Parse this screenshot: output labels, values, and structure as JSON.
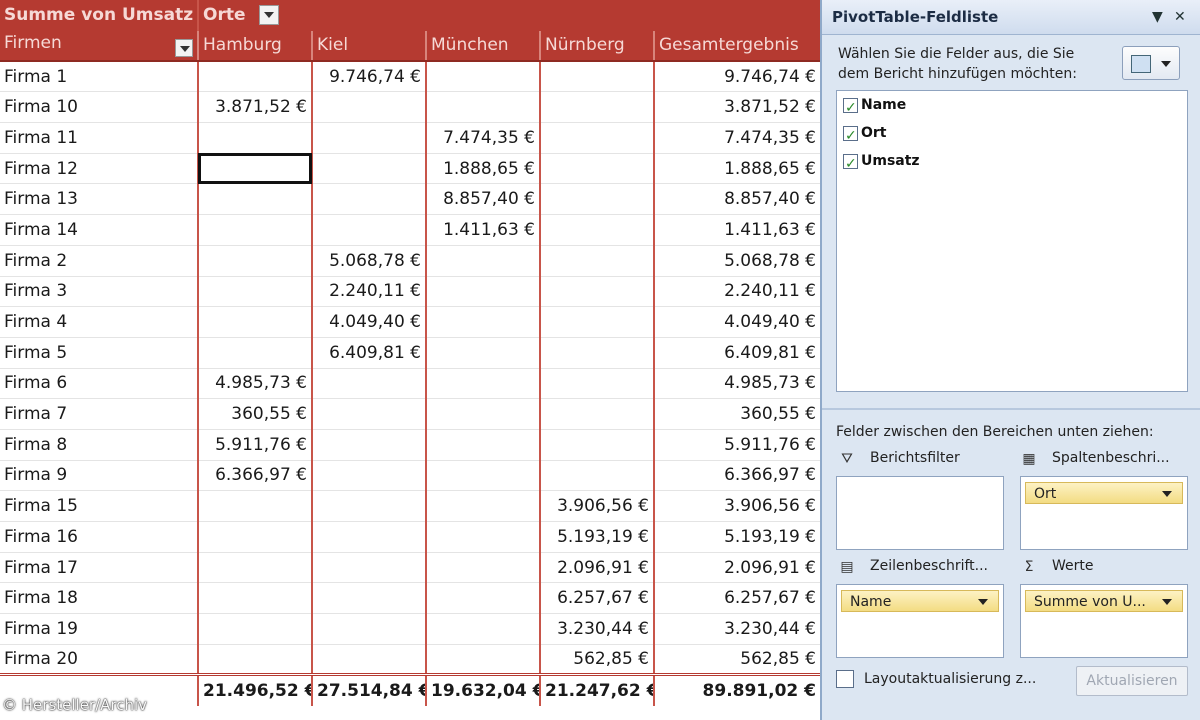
{
  "pivot": {
    "header1": {
      "values_label": "Summe von Umsatz",
      "column_field": "Orte"
    },
    "header2": {
      "row_field": "Firmen",
      "columns": [
        "Hamburg",
        "Kiel",
        "München",
        "Nürnberg"
      ],
      "grand_total": "Gesamtergebnis"
    },
    "rows": [
      {
        "name": "Firma 1",
        "cells": [
          "",
          "9.746,74 €",
          "",
          ""
        ],
        "total": "9.746,74 €"
      },
      {
        "name": "Firma 10",
        "cells": [
          "3.871,52 €",
          "",
          "",
          ""
        ],
        "total": "3.871,52 €"
      },
      {
        "name": "Firma 11",
        "cells": [
          "",
          "",
          "7.474,35 €",
          ""
        ],
        "total": "7.474,35 €"
      },
      {
        "name": "Firma 12",
        "cells": [
          "",
          "",
          "1.888,65 €",
          ""
        ],
        "total": "1.888,65 €"
      },
      {
        "name": "Firma 13",
        "cells": [
          "",
          "",
          "8.857,40 €",
          ""
        ],
        "total": "8.857,40 €"
      },
      {
        "name": "Firma 14",
        "cells": [
          "",
          "",
          "1.411,63 €",
          ""
        ],
        "total": "1.411,63 €"
      },
      {
        "name": "Firma 2",
        "cells": [
          "",
          "5.068,78 €",
          "",
          ""
        ],
        "total": "5.068,78 €"
      },
      {
        "name": "Firma 3",
        "cells": [
          "",
          "2.240,11 €",
          "",
          ""
        ],
        "total": "2.240,11 €"
      },
      {
        "name": "Firma 4",
        "cells": [
          "",
          "4.049,40 €",
          "",
          ""
        ],
        "total": "4.049,40 €"
      },
      {
        "name": "Firma 5",
        "cells": [
          "",
          "6.409,81 €",
          "",
          ""
        ],
        "total": "6.409,81 €"
      },
      {
        "name": "Firma 6",
        "cells": [
          "4.985,73 €",
          "",
          "",
          ""
        ],
        "total": "4.985,73 €"
      },
      {
        "name": "Firma 7",
        "cells": [
          "360,55 €",
          "",
          "",
          ""
        ],
        "total": "360,55 €"
      },
      {
        "name": "Firma 8",
        "cells": [
          "5.911,76 €",
          "",
          "",
          ""
        ],
        "total": "5.911,76 €"
      },
      {
        "name": "Firma 9",
        "cells": [
          "6.366,97 €",
          "",
          "",
          ""
        ],
        "total": "6.366,97 €"
      },
      {
        "name": "Firma 15",
        "cells": [
          "",
          "",
          "",
          "3.906,56 €"
        ],
        "total": "3.906,56 €"
      },
      {
        "name": "Firma 16",
        "cells": [
          "",
          "",
          "",
          "5.193,19 €"
        ],
        "total": "5.193,19 €"
      },
      {
        "name": "Firma 17",
        "cells": [
          "",
          "",
          "",
          "2.096,91 €"
        ],
        "total": "2.096,91 €"
      },
      {
        "name": "Firma 18",
        "cells": [
          "",
          "",
          "",
          "6.257,67 €"
        ],
        "total": "6.257,67 €"
      },
      {
        "name": "Firma 19",
        "cells": [
          "",
          "",
          "",
          "3.230,44 €"
        ],
        "total": "3.230,44 €"
      },
      {
        "name": "Firma 20",
        "cells": [
          "",
          "",
          "",
          "562,85 €"
        ],
        "total": "562,85 €"
      }
    ],
    "totals": {
      "cells": [
        "21.496,52 €",
        "27.514,84 €",
        "19.632,04 €",
        "21.247,62 €"
      ],
      "total": "89.891,02 €"
    }
  },
  "copyright": "© Hersteller/Archiv",
  "field_list": {
    "title": "PivotTable-Feldliste",
    "dropdown_glyph": "▼",
    "close_glyph": "✕",
    "instruction": "Wählen Sie die Felder aus, die Sie dem Bericht hinzufügen möchten:",
    "fields": [
      {
        "label": "Name",
        "checked": true
      },
      {
        "label": "Ort",
        "checked": true
      },
      {
        "label": "Umsatz",
        "checked": true
      }
    ],
    "drag_instruction": "Felder zwischen den Bereichen unten ziehen:",
    "zones": {
      "report_filter": {
        "label": "Berichtsfilter",
        "icon": "filter-icon",
        "glyph": "⛛"
      },
      "column_labels": {
        "label": "Spaltenbeschri...",
        "icon": "column-grid-icon",
        "glyph": "▦",
        "items": [
          "Ort"
        ]
      },
      "row_labels": {
        "label": "Zeilenbeschrift...",
        "icon": "row-grid-icon",
        "glyph": "▤",
        "items": [
          "Name"
        ]
      },
      "values": {
        "label": "Werte",
        "icon": "sigma-icon",
        "glyph": "Σ",
        "items": [
          "Summe von U..."
        ]
      }
    },
    "defer_label": "Layoutaktualisierung z...",
    "update_button": "Aktualisieren"
  },
  "colors": {
    "header_bg": "#b53a31",
    "pane_bg": "#dce6f2",
    "chip_bg": "#f3dc83"
  }
}
